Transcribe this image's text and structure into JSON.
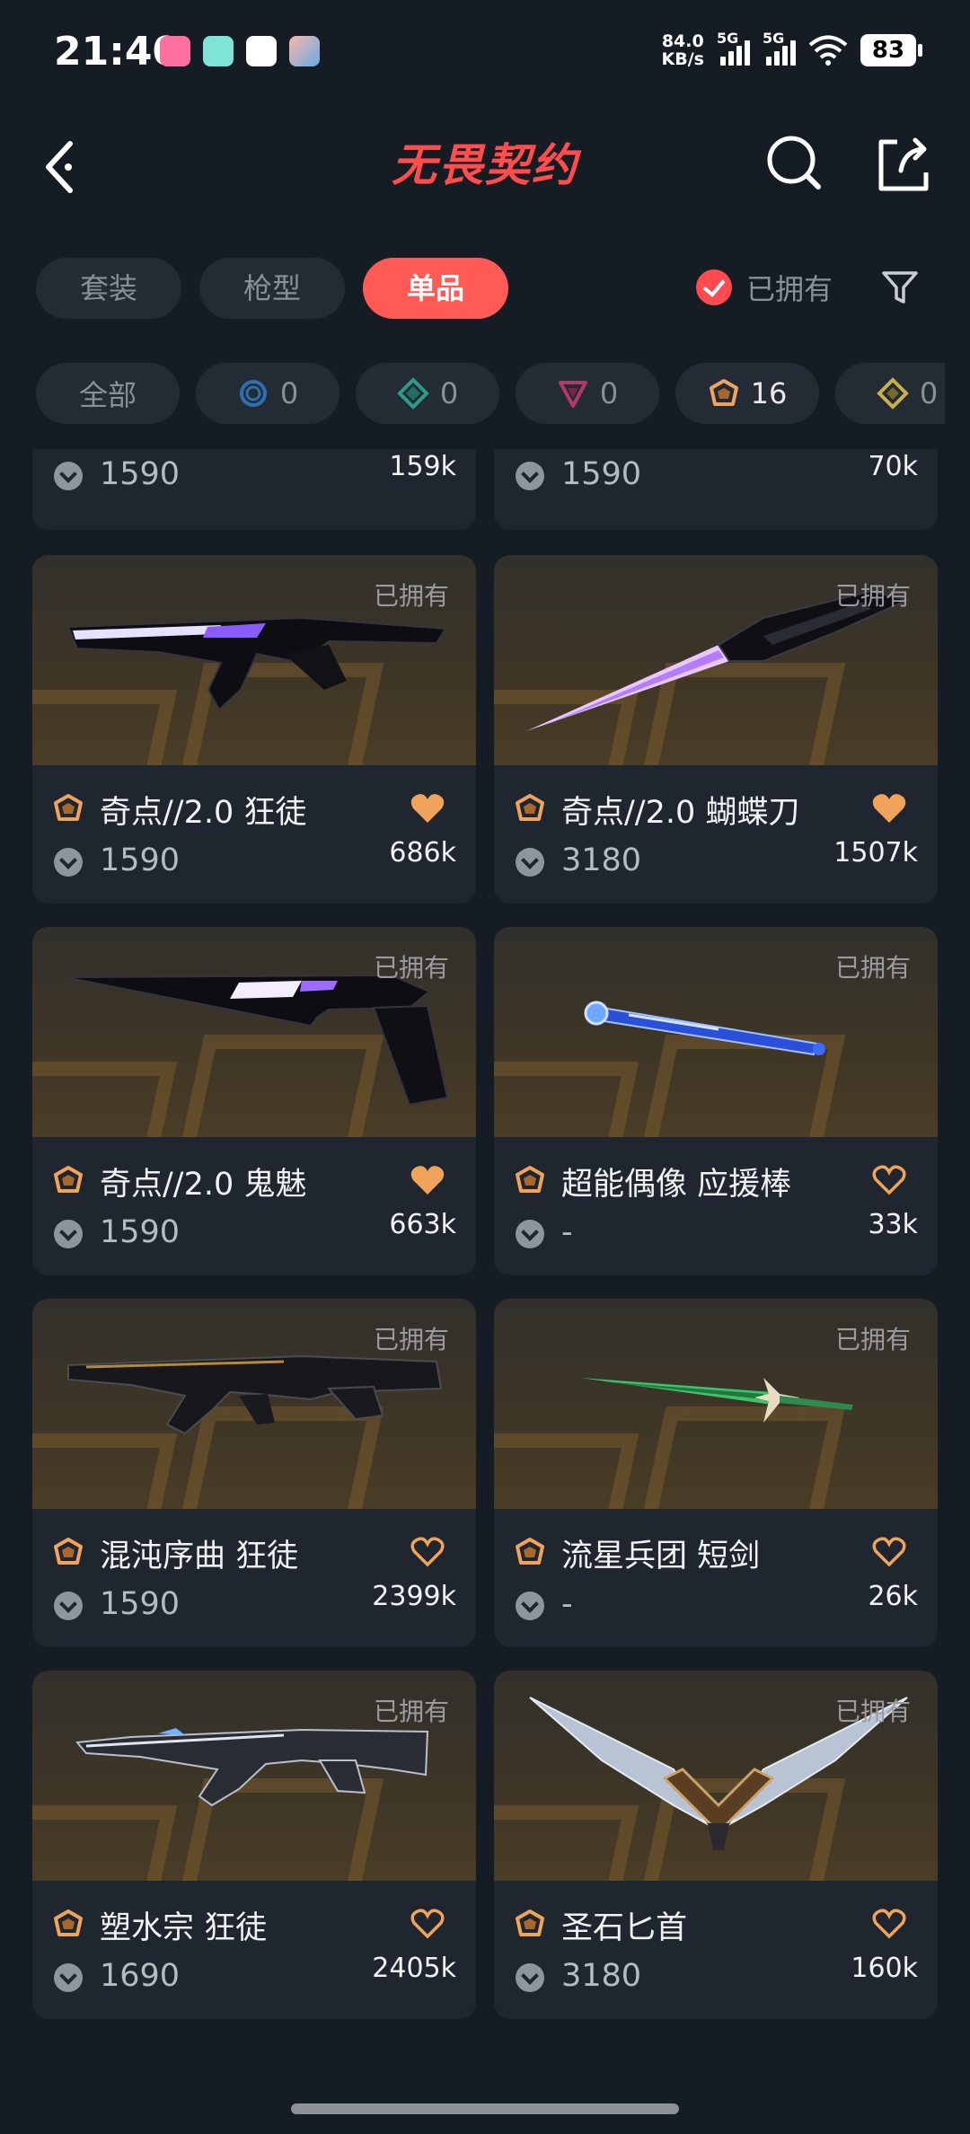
{
  "status_bar": {
    "time": "21:40",
    "net_speed_value": "84.0",
    "net_speed_unit": "KB/s",
    "sim1_label": "5G",
    "sim2_label": "5G",
    "battery": "83",
    "app_icons": [
      "lofter-app-icon",
      "notes-app-icon",
      "meituan-app-icon",
      "game-app-icon"
    ]
  },
  "header": {
    "title": "无畏契约",
    "back_icon": "chevron-left-icon",
    "search_icon": "search-icon",
    "share_icon": "share-icon"
  },
  "tabs": [
    {
      "label": "套装",
      "active": false
    },
    {
      "label": "枪型",
      "active": false
    },
    {
      "label": "单品",
      "active": true
    }
  ],
  "owned_filter": {
    "label": "已拥有",
    "checked": true
  },
  "tiers": [
    {
      "label": "全部",
      "icon": null,
      "count": null
    },
    {
      "icon": "select-tier-icon",
      "color": "#2f6fb0",
      "count": "0"
    },
    {
      "icon": "deluxe-tier-icon",
      "color": "#2e9a8a",
      "count": "0"
    },
    {
      "icon": "premium-tier-icon",
      "color": "#b2376b",
      "count": "0"
    },
    {
      "icon": "exclusive-tier-icon",
      "color": "#f0a35a",
      "count": "16"
    },
    {
      "icon": "ultra-tier-icon",
      "color": "#c9b04a",
      "count": "0"
    }
  ],
  "items": [
    {
      "name": "",
      "price": "1590",
      "likes": "159k",
      "owned_label": "",
      "liked": false,
      "partial": true
    },
    {
      "name": "",
      "price": "1590",
      "likes": "70k",
      "owned_label": "",
      "liked": false,
      "partial": true
    },
    {
      "name": "奇点//2.0 狂徒",
      "price": "1590",
      "likes": "686k",
      "owned_label": "已拥有",
      "liked": true,
      "weapon": "rifle-violet"
    },
    {
      "name": "奇点//2.0 蝴蝶刀",
      "price": "3180",
      "likes": "1507k",
      "owned_label": "已拥有",
      "liked": true,
      "weapon": "knife-violet"
    },
    {
      "name": "奇点//2.0 鬼魅",
      "price": "1590",
      "likes": "663k",
      "owned_label": "已拥有",
      "liked": true,
      "weapon": "pistol-violet"
    },
    {
      "name": "超能偶像 应援棒",
      "price": "-",
      "likes": "33k",
      "owned_label": "已拥有",
      "liked": false,
      "weapon": "glowstick"
    },
    {
      "name": "混沌序曲 狂徒",
      "price": "1590",
      "likes": "2399k",
      "owned_label": "已拥有",
      "liked": false,
      "weapon": "rifle-dark"
    },
    {
      "name": "流星兵团 短剑",
      "price": "-",
      "likes": "26k",
      "owned_label": "已拥有",
      "liked": false,
      "weapon": "dagger-green"
    },
    {
      "name": "塑水宗 狂徒",
      "price": "1690",
      "likes": "2405k",
      "owned_label": "已拥有",
      "liked": false,
      "weapon": "rifle-silver"
    },
    {
      "name": "圣石匕首",
      "price": "3180",
      "likes": "160k",
      "owned_label": "已拥有",
      "liked": false,
      "weapon": "winged-knife"
    }
  ],
  "colors": {
    "accent": "#ff5a56",
    "heart": "#f0a35a",
    "background": "#161c24",
    "card": "#1f262f"
  }
}
